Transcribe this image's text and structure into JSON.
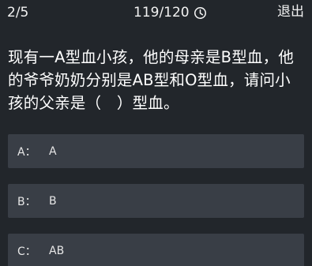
{
  "header": {
    "progress": "2/5",
    "timer": "119/120",
    "exit_label": "退出"
  },
  "question": {
    "text": "现有一A型血小孩，他的母亲是B型血，他的爷爷奶奶分别是AB型和O型血，请问小孩的父亲是（　）型血。"
  },
  "options": [
    {
      "letter": "A：",
      "text": "A"
    },
    {
      "letter": "B：",
      "text": "B"
    },
    {
      "letter": "C：",
      "text": "AB"
    }
  ],
  "icons": {
    "timer": "clock-icon"
  },
  "colors": {
    "background": "#22262b",
    "option_background": "#393e46",
    "text": "#ffffff"
  }
}
